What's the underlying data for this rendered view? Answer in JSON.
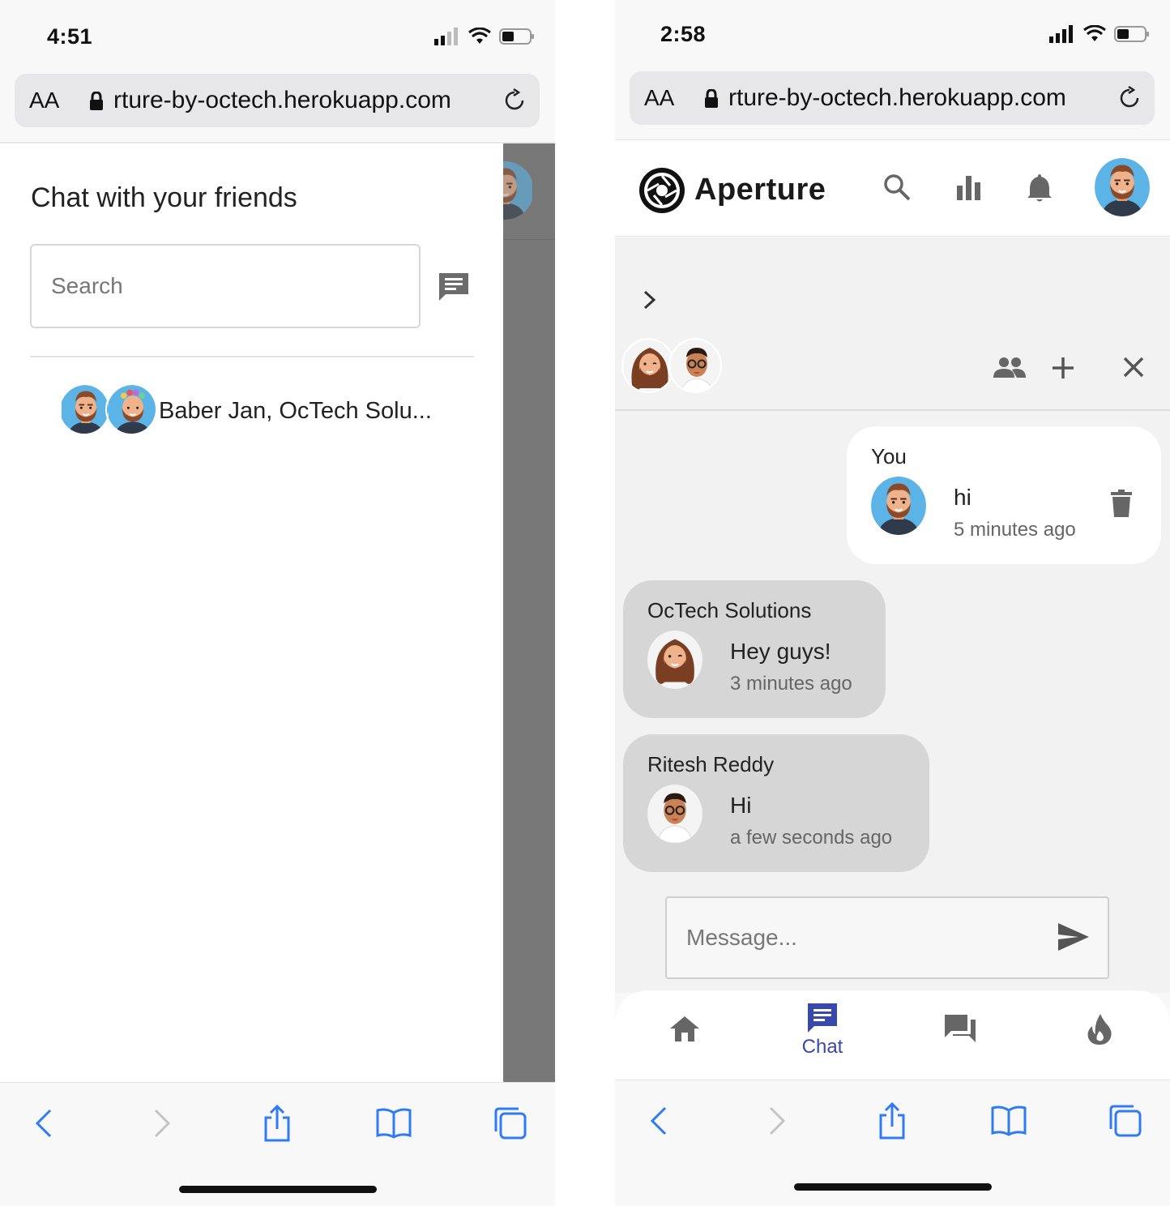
{
  "left": {
    "status_time": "4:51",
    "url": {
      "aa": "AA",
      "text": "rture-by-octech.herokuapp.com"
    },
    "drawer": {
      "title": "Chat with your friends",
      "search_placeholder": "Search",
      "conversations": [
        {
          "name": "Baber Jan, OcTech Solu..."
        }
      ]
    }
  },
  "right": {
    "status_time": "2:58",
    "url": {
      "aa": "AA",
      "text": "rture-by-octech.herokuapp.com"
    },
    "header": {
      "brand": "Aperture",
      "icons": [
        "search-icon",
        "bar-chart-icon",
        "bell-icon"
      ]
    },
    "chat": {
      "tools": [
        "group-icon",
        "add-icon",
        "close-icon"
      ],
      "messages": [
        {
          "sender": "You",
          "text": "hi",
          "time": "5 minutes ago"
        },
        {
          "sender": "OcTech Solutions",
          "text": "Hey guys!",
          "time": "3 minutes ago"
        },
        {
          "sender": "Ritesh Reddy",
          "text": "Hi",
          "time": "a few seconds ago"
        }
      ],
      "input_placeholder": "Message..."
    },
    "bottom_nav": {
      "items": [
        {
          "icon": "home-icon",
          "label": ""
        },
        {
          "icon": "chat-icon",
          "label": "Chat",
          "active": true
        },
        {
          "icon": "forum-icon",
          "label": ""
        },
        {
          "icon": "flame-icon",
          "label": ""
        }
      ]
    }
  },
  "colors": {
    "safari_blue": "#2f7bf6",
    "active_nav": "#3949ab",
    "avatar_blue": "#5cb3e6",
    "bubble_grey": "#d6d6d6"
  }
}
